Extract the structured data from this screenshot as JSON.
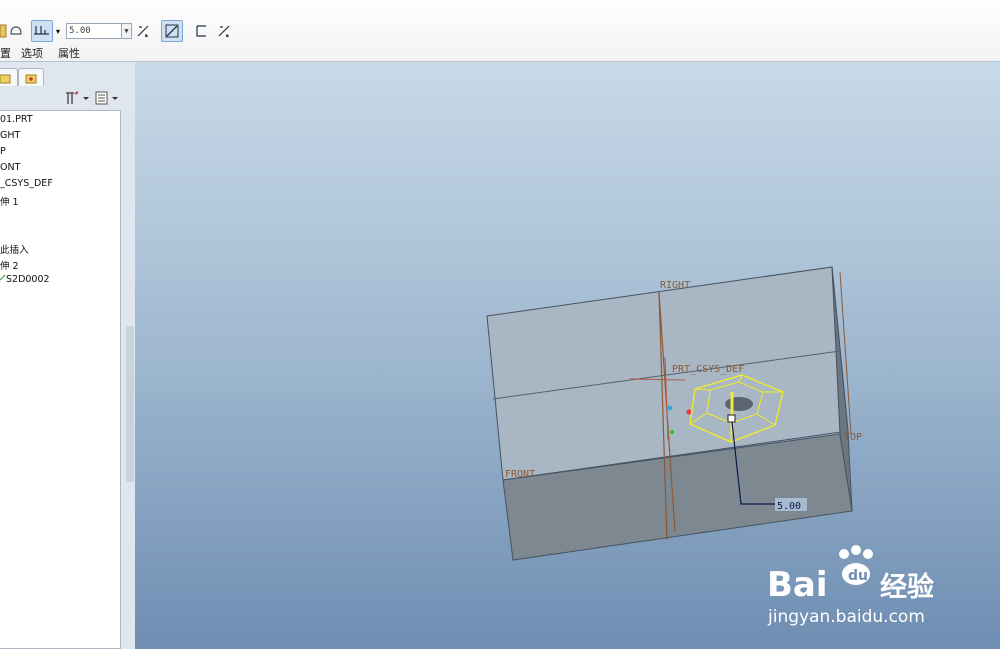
{
  "toolbar": {
    "depth_value": "5.00",
    "depth_dropdown_arrow": "▾",
    "tabs": [
      "置",
      "选项",
      "属性"
    ]
  },
  "model_tree": {
    "items": [
      "01.PRT",
      "GHT",
      "P",
      "ONT",
      "_CSYS_DEF",
      "伸 1",
      "此插入",
      "伸 2",
      "S2D0002"
    ]
  },
  "viewport": {
    "datum_labels": {
      "right": "RIGHT",
      "top": "TOP",
      "front": "FRONT",
      "csys": "PRT_CSYS_DEF"
    },
    "dimension_value": "5.00"
  },
  "watermark": {
    "brand": "Bai",
    "brand_suffix": "经验",
    "url": "jingyan.baidu.com"
  },
  "colors": {
    "viewport_top": "#c8dae8",
    "viewport_bottom": "#6e8db2",
    "selection_yellow": "#f0f020",
    "datum_brown": "#8b5a35"
  }
}
